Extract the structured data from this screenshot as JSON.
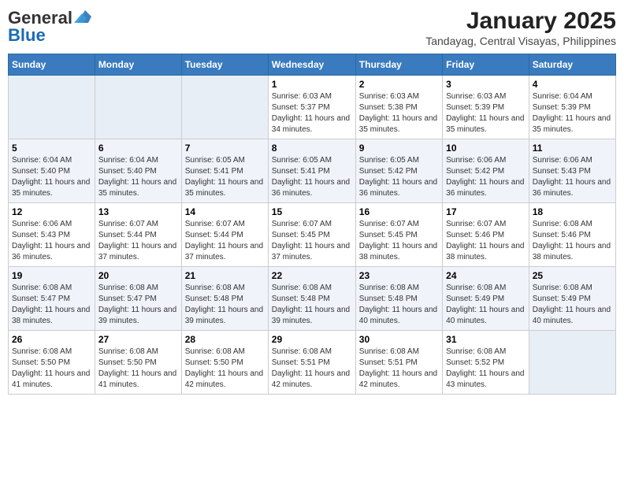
{
  "header": {
    "logo_line1": "General",
    "logo_line2": "Blue",
    "title": "January 2025",
    "subtitle": "Tandayag, Central Visayas, Philippines"
  },
  "weekdays": [
    "Sunday",
    "Monday",
    "Tuesday",
    "Wednesday",
    "Thursday",
    "Friday",
    "Saturday"
  ],
  "weeks": [
    [
      {
        "day": "",
        "info": ""
      },
      {
        "day": "",
        "info": ""
      },
      {
        "day": "",
        "info": ""
      },
      {
        "day": "1",
        "info": "Sunrise: 6:03 AM\nSunset: 5:37 PM\nDaylight: 11 hours and 34 minutes."
      },
      {
        "day": "2",
        "info": "Sunrise: 6:03 AM\nSunset: 5:38 PM\nDaylight: 11 hours and 35 minutes."
      },
      {
        "day": "3",
        "info": "Sunrise: 6:03 AM\nSunset: 5:39 PM\nDaylight: 11 hours and 35 minutes."
      },
      {
        "day": "4",
        "info": "Sunrise: 6:04 AM\nSunset: 5:39 PM\nDaylight: 11 hours and 35 minutes."
      }
    ],
    [
      {
        "day": "5",
        "info": "Sunrise: 6:04 AM\nSunset: 5:40 PM\nDaylight: 11 hours and 35 minutes."
      },
      {
        "day": "6",
        "info": "Sunrise: 6:04 AM\nSunset: 5:40 PM\nDaylight: 11 hours and 35 minutes."
      },
      {
        "day": "7",
        "info": "Sunrise: 6:05 AM\nSunset: 5:41 PM\nDaylight: 11 hours and 35 minutes."
      },
      {
        "day": "8",
        "info": "Sunrise: 6:05 AM\nSunset: 5:41 PM\nDaylight: 11 hours and 36 minutes."
      },
      {
        "day": "9",
        "info": "Sunrise: 6:05 AM\nSunset: 5:42 PM\nDaylight: 11 hours and 36 minutes."
      },
      {
        "day": "10",
        "info": "Sunrise: 6:06 AM\nSunset: 5:42 PM\nDaylight: 11 hours and 36 minutes."
      },
      {
        "day": "11",
        "info": "Sunrise: 6:06 AM\nSunset: 5:43 PM\nDaylight: 11 hours and 36 minutes."
      }
    ],
    [
      {
        "day": "12",
        "info": "Sunrise: 6:06 AM\nSunset: 5:43 PM\nDaylight: 11 hours and 36 minutes."
      },
      {
        "day": "13",
        "info": "Sunrise: 6:07 AM\nSunset: 5:44 PM\nDaylight: 11 hours and 37 minutes."
      },
      {
        "day": "14",
        "info": "Sunrise: 6:07 AM\nSunset: 5:44 PM\nDaylight: 11 hours and 37 minutes."
      },
      {
        "day": "15",
        "info": "Sunrise: 6:07 AM\nSunset: 5:45 PM\nDaylight: 11 hours and 37 minutes."
      },
      {
        "day": "16",
        "info": "Sunrise: 6:07 AM\nSunset: 5:45 PM\nDaylight: 11 hours and 38 minutes."
      },
      {
        "day": "17",
        "info": "Sunrise: 6:07 AM\nSunset: 5:46 PM\nDaylight: 11 hours and 38 minutes."
      },
      {
        "day": "18",
        "info": "Sunrise: 6:08 AM\nSunset: 5:46 PM\nDaylight: 11 hours and 38 minutes."
      }
    ],
    [
      {
        "day": "19",
        "info": "Sunrise: 6:08 AM\nSunset: 5:47 PM\nDaylight: 11 hours and 38 minutes."
      },
      {
        "day": "20",
        "info": "Sunrise: 6:08 AM\nSunset: 5:47 PM\nDaylight: 11 hours and 39 minutes."
      },
      {
        "day": "21",
        "info": "Sunrise: 6:08 AM\nSunset: 5:48 PM\nDaylight: 11 hours and 39 minutes."
      },
      {
        "day": "22",
        "info": "Sunrise: 6:08 AM\nSunset: 5:48 PM\nDaylight: 11 hours and 39 minutes."
      },
      {
        "day": "23",
        "info": "Sunrise: 6:08 AM\nSunset: 5:48 PM\nDaylight: 11 hours and 40 minutes."
      },
      {
        "day": "24",
        "info": "Sunrise: 6:08 AM\nSunset: 5:49 PM\nDaylight: 11 hours and 40 minutes."
      },
      {
        "day": "25",
        "info": "Sunrise: 6:08 AM\nSunset: 5:49 PM\nDaylight: 11 hours and 40 minutes."
      }
    ],
    [
      {
        "day": "26",
        "info": "Sunrise: 6:08 AM\nSunset: 5:50 PM\nDaylight: 11 hours and 41 minutes."
      },
      {
        "day": "27",
        "info": "Sunrise: 6:08 AM\nSunset: 5:50 PM\nDaylight: 11 hours and 41 minutes."
      },
      {
        "day": "28",
        "info": "Sunrise: 6:08 AM\nSunset: 5:50 PM\nDaylight: 11 hours and 42 minutes."
      },
      {
        "day": "29",
        "info": "Sunrise: 6:08 AM\nSunset: 5:51 PM\nDaylight: 11 hours and 42 minutes."
      },
      {
        "day": "30",
        "info": "Sunrise: 6:08 AM\nSunset: 5:51 PM\nDaylight: 11 hours and 42 minutes."
      },
      {
        "day": "31",
        "info": "Sunrise: 6:08 AM\nSunset: 5:52 PM\nDaylight: 11 hours and 43 minutes."
      },
      {
        "day": "",
        "info": ""
      }
    ]
  ]
}
